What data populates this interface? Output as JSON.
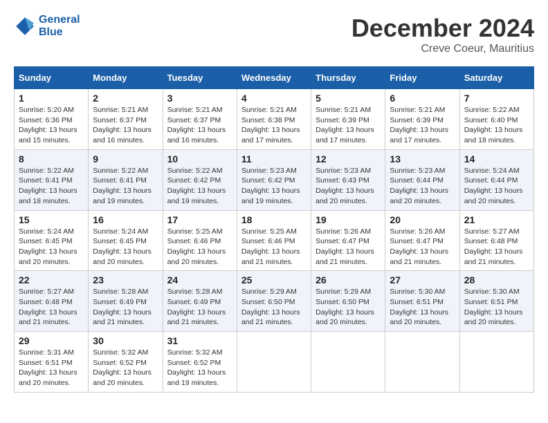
{
  "logo": {
    "line1": "General",
    "line2": "Blue"
  },
  "title": "December 2024",
  "location": "Creve Coeur, Mauritius",
  "days_of_week": [
    "Sunday",
    "Monday",
    "Tuesday",
    "Wednesday",
    "Thursday",
    "Friday",
    "Saturday"
  ],
  "weeks": [
    [
      {
        "day": "1",
        "info": "Sunrise: 5:20 AM\nSunset: 6:36 PM\nDaylight: 13 hours\nand 15 minutes."
      },
      {
        "day": "2",
        "info": "Sunrise: 5:21 AM\nSunset: 6:37 PM\nDaylight: 13 hours\nand 16 minutes."
      },
      {
        "day": "3",
        "info": "Sunrise: 5:21 AM\nSunset: 6:37 PM\nDaylight: 13 hours\nand 16 minutes."
      },
      {
        "day": "4",
        "info": "Sunrise: 5:21 AM\nSunset: 6:38 PM\nDaylight: 13 hours\nand 17 minutes."
      },
      {
        "day": "5",
        "info": "Sunrise: 5:21 AM\nSunset: 6:39 PM\nDaylight: 13 hours\nand 17 minutes."
      },
      {
        "day": "6",
        "info": "Sunrise: 5:21 AM\nSunset: 6:39 PM\nDaylight: 13 hours\nand 17 minutes."
      },
      {
        "day": "7",
        "info": "Sunrise: 5:22 AM\nSunset: 6:40 PM\nDaylight: 13 hours\nand 18 minutes."
      }
    ],
    [
      {
        "day": "8",
        "info": "Sunrise: 5:22 AM\nSunset: 6:41 PM\nDaylight: 13 hours\nand 18 minutes."
      },
      {
        "day": "9",
        "info": "Sunrise: 5:22 AM\nSunset: 6:41 PM\nDaylight: 13 hours\nand 19 minutes."
      },
      {
        "day": "10",
        "info": "Sunrise: 5:22 AM\nSunset: 6:42 PM\nDaylight: 13 hours\nand 19 minutes."
      },
      {
        "day": "11",
        "info": "Sunrise: 5:23 AM\nSunset: 6:42 PM\nDaylight: 13 hours\nand 19 minutes."
      },
      {
        "day": "12",
        "info": "Sunrise: 5:23 AM\nSunset: 6:43 PM\nDaylight: 13 hours\nand 20 minutes."
      },
      {
        "day": "13",
        "info": "Sunrise: 5:23 AM\nSunset: 6:44 PM\nDaylight: 13 hours\nand 20 minutes."
      },
      {
        "day": "14",
        "info": "Sunrise: 5:24 AM\nSunset: 6:44 PM\nDaylight: 13 hours\nand 20 minutes."
      }
    ],
    [
      {
        "day": "15",
        "info": "Sunrise: 5:24 AM\nSunset: 6:45 PM\nDaylight: 13 hours\nand 20 minutes."
      },
      {
        "day": "16",
        "info": "Sunrise: 5:24 AM\nSunset: 6:45 PM\nDaylight: 13 hours\nand 20 minutes."
      },
      {
        "day": "17",
        "info": "Sunrise: 5:25 AM\nSunset: 6:46 PM\nDaylight: 13 hours\nand 20 minutes."
      },
      {
        "day": "18",
        "info": "Sunrise: 5:25 AM\nSunset: 6:46 PM\nDaylight: 13 hours\nand 21 minutes."
      },
      {
        "day": "19",
        "info": "Sunrise: 5:26 AM\nSunset: 6:47 PM\nDaylight: 13 hours\nand 21 minutes."
      },
      {
        "day": "20",
        "info": "Sunrise: 5:26 AM\nSunset: 6:47 PM\nDaylight: 13 hours\nand 21 minutes."
      },
      {
        "day": "21",
        "info": "Sunrise: 5:27 AM\nSunset: 6:48 PM\nDaylight: 13 hours\nand 21 minutes."
      }
    ],
    [
      {
        "day": "22",
        "info": "Sunrise: 5:27 AM\nSunset: 6:48 PM\nDaylight: 13 hours\nand 21 minutes."
      },
      {
        "day": "23",
        "info": "Sunrise: 5:28 AM\nSunset: 6:49 PM\nDaylight: 13 hours\nand 21 minutes."
      },
      {
        "day": "24",
        "info": "Sunrise: 5:28 AM\nSunset: 6:49 PM\nDaylight: 13 hours\nand 21 minutes."
      },
      {
        "day": "25",
        "info": "Sunrise: 5:29 AM\nSunset: 6:50 PM\nDaylight: 13 hours\nand 21 minutes."
      },
      {
        "day": "26",
        "info": "Sunrise: 5:29 AM\nSunset: 6:50 PM\nDaylight: 13 hours\nand 20 minutes."
      },
      {
        "day": "27",
        "info": "Sunrise: 5:30 AM\nSunset: 6:51 PM\nDaylight: 13 hours\nand 20 minutes."
      },
      {
        "day": "28",
        "info": "Sunrise: 5:30 AM\nSunset: 6:51 PM\nDaylight: 13 hours\nand 20 minutes."
      }
    ],
    [
      {
        "day": "29",
        "info": "Sunrise: 5:31 AM\nSunset: 6:51 PM\nDaylight: 13 hours\nand 20 minutes."
      },
      {
        "day": "30",
        "info": "Sunrise: 5:32 AM\nSunset: 6:52 PM\nDaylight: 13 hours\nand 20 minutes."
      },
      {
        "day": "31",
        "info": "Sunrise: 5:32 AM\nSunset: 6:52 PM\nDaylight: 13 hours\nand 19 minutes."
      },
      {
        "day": "",
        "info": ""
      },
      {
        "day": "",
        "info": ""
      },
      {
        "day": "",
        "info": ""
      },
      {
        "day": "",
        "info": ""
      }
    ]
  ]
}
